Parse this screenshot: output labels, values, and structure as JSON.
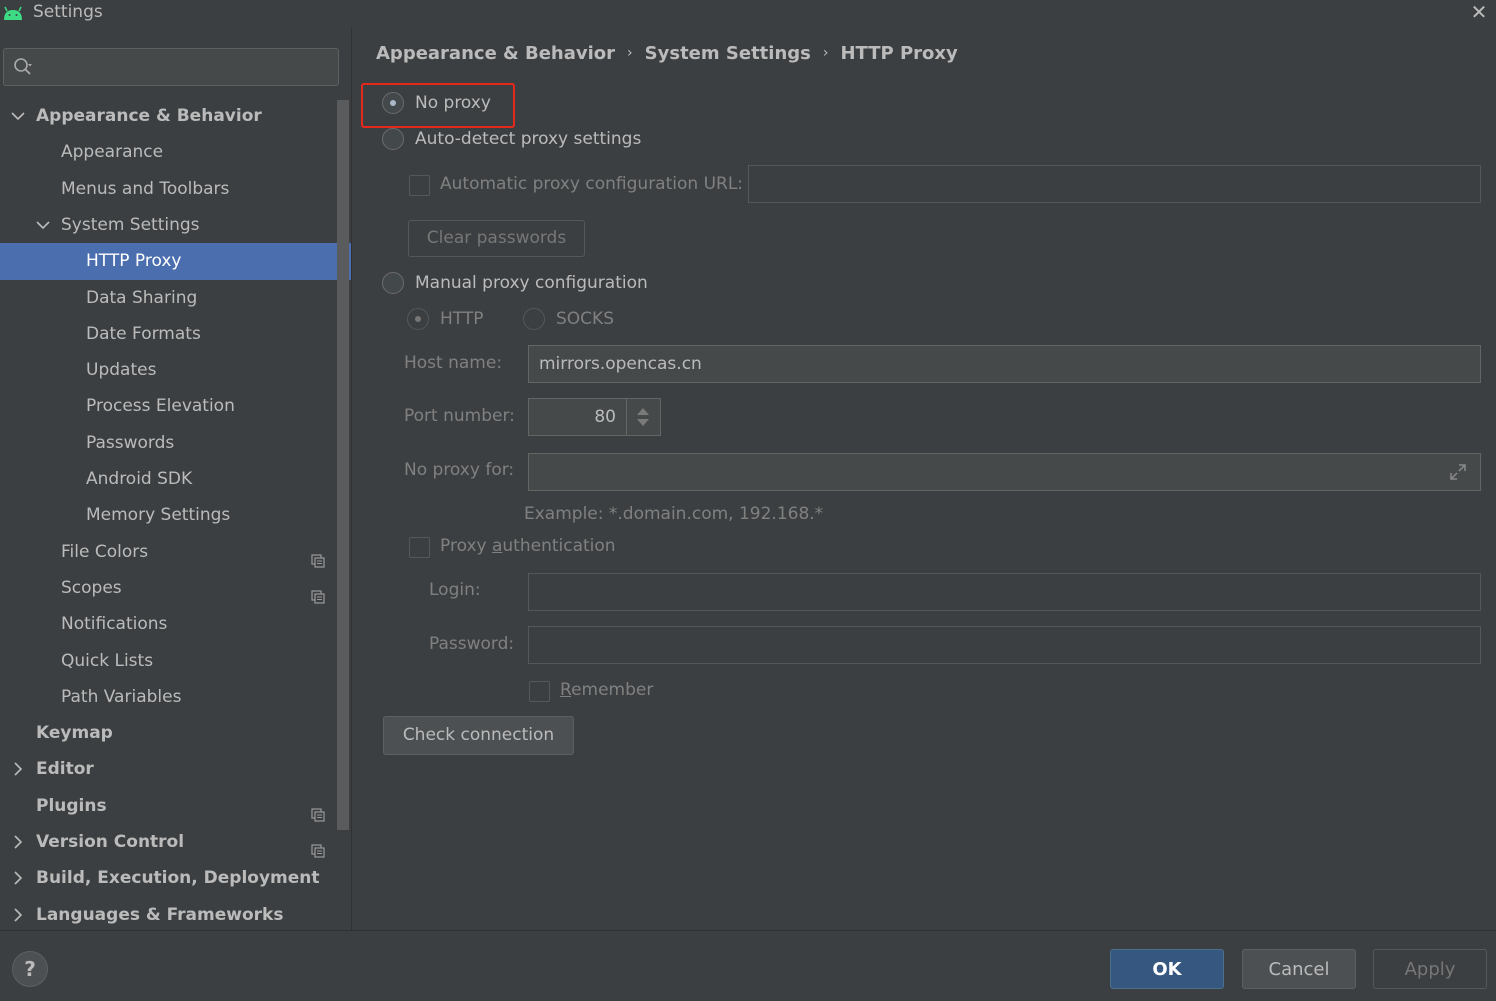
{
  "window": {
    "title": "Settings"
  },
  "search": {
    "placeholder": ""
  },
  "tree": [
    {
      "label": "Appearance & Behavior",
      "bold": true,
      "indent": 0,
      "chevron": "down"
    },
    {
      "label": "Appearance",
      "indent": 1
    },
    {
      "label": "Menus and Toolbars",
      "indent": 1
    },
    {
      "label": "System Settings",
      "indent": 1,
      "chevron": "down"
    },
    {
      "label": "HTTP Proxy",
      "indent": 2,
      "selected": true
    },
    {
      "label": "Data Sharing",
      "indent": 2
    },
    {
      "label": "Date Formats",
      "indent": 2
    },
    {
      "label": "Updates",
      "indent": 2
    },
    {
      "label": "Process Elevation",
      "indent": 2
    },
    {
      "label": "Passwords",
      "indent": 2
    },
    {
      "label": "Android SDK",
      "indent": 2
    },
    {
      "label": "Memory Settings",
      "indent": 2
    },
    {
      "label": "File Colors",
      "indent": 1,
      "copy": true
    },
    {
      "label": "Scopes",
      "indent": 1,
      "copy": true
    },
    {
      "label": "Notifications",
      "indent": 1
    },
    {
      "label": "Quick Lists",
      "indent": 1
    },
    {
      "label": "Path Variables",
      "indent": 1
    },
    {
      "label": "Keymap",
      "bold": true,
      "indent": 0
    },
    {
      "label": "Editor",
      "bold": true,
      "indent": 0,
      "chevron": "right"
    },
    {
      "label": "Plugins",
      "bold": true,
      "indent": 0,
      "copy": true
    },
    {
      "label": "Version Control",
      "bold": true,
      "indent": 0,
      "chevron": "right",
      "copy": true
    },
    {
      "label": "Build, Execution, Deployment",
      "bold": true,
      "indent": 0,
      "chevron": "right"
    },
    {
      "label": "Languages & Frameworks",
      "bold": true,
      "indent": 0,
      "chevron": "right"
    }
  ],
  "breadcrumb": [
    "Appearance & Behavior",
    "System Settings",
    "HTTP Proxy"
  ],
  "proxy": {
    "no_proxy": "No proxy",
    "auto_detect": "Auto-detect proxy settings",
    "auto_config_url": "Automatic proxy configuration URL:",
    "auto_config_value": "",
    "clear_passwords": "Clear passwords",
    "manual": "Manual proxy configuration",
    "http": "HTTP",
    "socks": "SOCKS",
    "host_label": "Host name:",
    "host_value": "mirrors.opencas.cn",
    "port_label": "Port number:",
    "port_value": "80",
    "no_proxy_for_label": "No proxy for:",
    "no_proxy_for_value": "",
    "example": "Example: *.domain.com, 192.168.*",
    "proxy_auth_pre": "Proxy ",
    "proxy_auth_u": "a",
    "proxy_auth_post": "uthentication",
    "login_label": "Login:",
    "login_value": "",
    "password_label": "Password:",
    "password_value": "",
    "remember_u": "R",
    "remember_post": "emember",
    "check_connection": "Check connection"
  },
  "footer": {
    "help": "?",
    "ok": "OK",
    "cancel": "Cancel",
    "apply": "Apply"
  },
  "colors": {
    "background": "#3c3f41",
    "selection": "#4b6eaf",
    "ok_button": "#365880",
    "highlight": "#e5281c"
  }
}
